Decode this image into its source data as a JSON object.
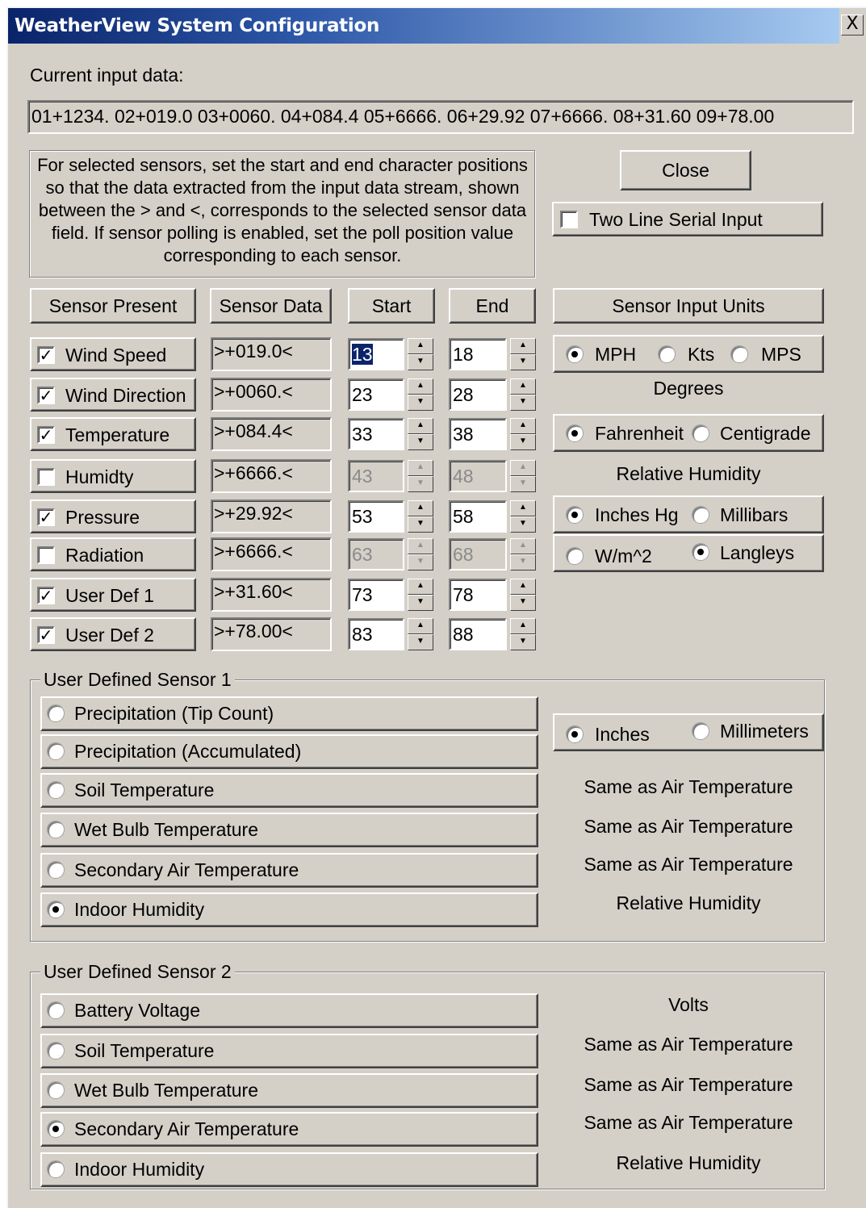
{
  "window": {
    "title": "WeatherView System Configuration",
    "close_glyph": "X"
  },
  "input": {
    "label": "Current input data:",
    "value": "01+1234.  02+019.0  03+0060.  04+084.4  05+6666.  06+29.92  07+6666.  08+31.60  09+78.00"
  },
  "instructions": "For selected sensors, set the start and end character positions so that the data extracted from the input data stream, shown between the > and <, corresponds to the selected sensor data field. If sensor polling is enabled, set the poll position value corresponding to each sensor.",
  "buttons": {
    "close": "Close",
    "two_line": "Two Line Serial Input",
    "two_line_checked": false
  },
  "headers": {
    "present": "Sensor Present",
    "data": "Sensor Data",
    "start": "Start",
    "end": "End",
    "units": "Sensor Input Units"
  },
  "sensors": [
    {
      "name": "Wind Speed",
      "checked": true,
      "data": ">+019.0<",
      "start": "13",
      "end": "18",
      "enabled": true
    },
    {
      "name": "Wind Direction",
      "checked": true,
      "data": ">+0060.<",
      "start": "23",
      "end": "28",
      "enabled": true
    },
    {
      "name": "Temperature",
      "checked": true,
      "data": ">+084.4<",
      "start": "33",
      "end": "38",
      "enabled": true
    },
    {
      "name": "Humidty",
      "checked": false,
      "data": ">+6666.<",
      "start": "43",
      "end": "48",
      "enabled": false
    },
    {
      "name": "Pressure",
      "checked": true,
      "data": ">+29.92<",
      "start": "53",
      "end": "58",
      "enabled": true
    },
    {
      "name": "Radiation",
      "checked": false,
      "data": ">+6666.<",
      "start": "63",
      "end": "68",
      "enabled": false
    },
    {
      "name": "User Def 1",
      "checked": true,
      "data": ">+31.60<",
      "start": "73",
      "end": "78",
      "enabled": true
    },
    {
      "name": "User Def 2",
      "checked": true,
      "data": ">+78.00<",
      "start": "83",
      "end": "88",
      "enabled": true
    }
  ],
  "units": {
    "wind": {
      "mph": "MPH",
      "kts": "Kts",
      "mps": "MPS",
      "selected": "MPH"
    },
    "direction": "Degrees",
    "temp": {
      "f": "Fahrenheit",
      "c": "Centigrade",
      "selected": "Fahrenheit"
    },
    "humidity": "Relative Humidity",
    "pressure": {
      "inhg": "Inches Hg",
      "mb": "Millibars",
      "selected": "Inches Hg"
    },
    "radiation": {
      "wm2": "W/m^2",
      "ly": "Langleys",
      "selected": "Langleys"
    }
  },
  "uds1": {
    "legend": "User Defined Sensor 1",
    "options": [
      {
        "label": "Precipitation (Tip Count)",
        "selected": false
      },
      {
        "label": "Precipitation (Accumulated)",
        "selected": false
      },
      {
        "label": "Soil Temperature",
        "selected": false,
        "unit": "Same as Air Temperature"
      },
      {
        "label": "Wet Bulb Temperature",
        "selected": false,
        "unit": "Same as Air Temperature"
      },
      {
        "label": "Secondary Air Temperature",
        "selected": false,
        "unit": "Same as Air Temperature"
      },
      {
        "label": "Indoor Humidity",
        "selected": true,
        "unit": "Relative Humidity"
      }
    ],
    "precip_units": {
      "inches": "Inches",
      "mm": "Millimeters",
      "selected": "Inches"
    }
  },
  "uds2": {
    "legend": "User Defined Sensor 2",
    "options": [
      {
        "label": "Battery Voltage",
        "selected": false,
        "unit": "Volts"
      },
      {
        "label": "Soil Temperature",
        "selected": false,
        "unit": "Same as Air Temperature"
      },
      {
        "label": "Wet Bulb Temperature",
        "selected": false,
        "unit": "Same as Air Temperature"
      },
      {
        "label": "Secondary Air Temperature",
        "selected": true,
        "unit": "Same as Air Temperature"
      },
      {
        "label": "Indoor Humidity",
        "selected": false,
        "unit": "Relative Humidity"
      }
    ]
  },
  "icons": {
    "check": "check-icon",
    "spin_up": "up-arrow-icon",
    "spin_down": "down-arrow-icon",
    "close": "close-icon"
  }
}
